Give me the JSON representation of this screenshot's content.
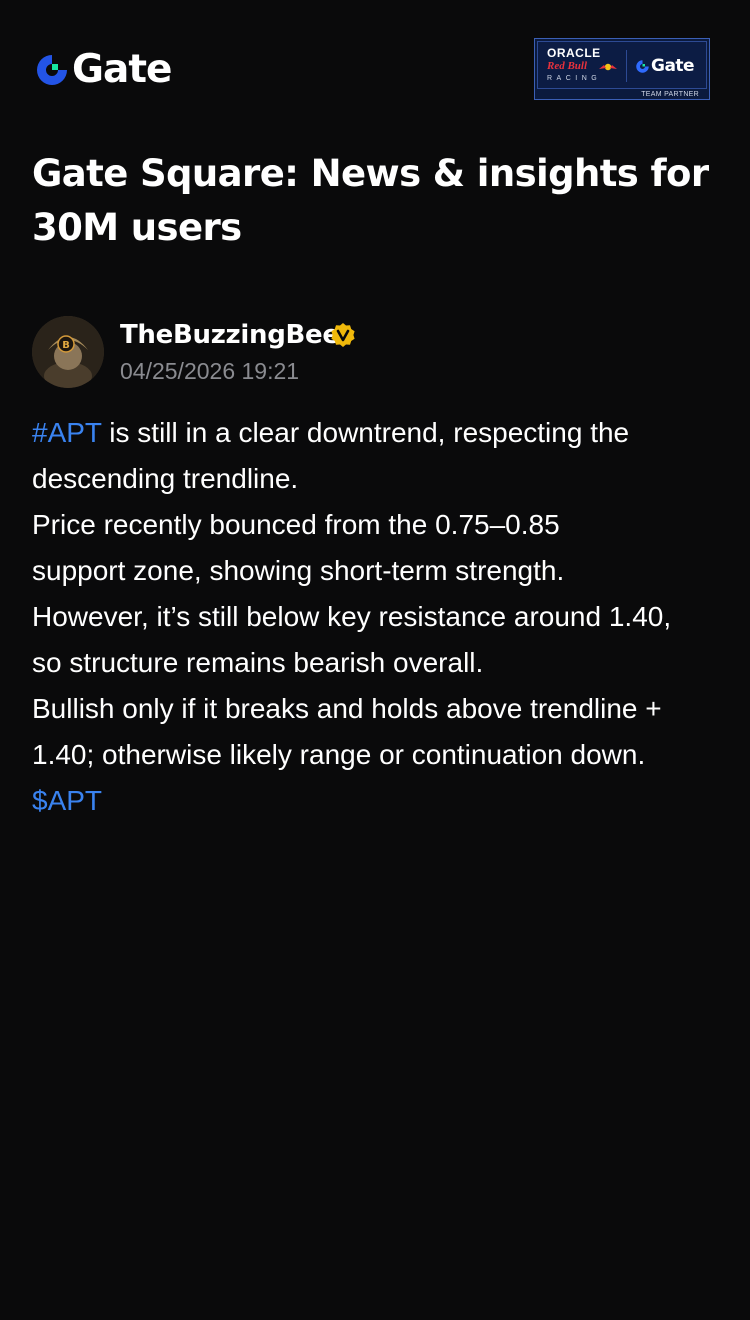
{
  "header": {
    "logo_text": "Gate",
    "partner_badge": {
      "oracle": "ORACLE",
      "redbull": "Red Bull",
      "racing": "RACING",
      "gate": "Gate",
      "team_partner": "TEAM PARTNER"
    }
  },
  "page": {
    "title_line1": "Gate Square: News & insights for",
    "title_line2": "30M users"
  },
  "post": {
    "author": "TheBuzzingBee",
    "timestamp": "04/25/2026 19:21",
    "body": {
      "hashtag": "#APT",
      "line1_rest": " is still in a clear downtrend, respecting the",
      "line2": "descending trendline.",
      "line3": "Price recently bounced from the 0.75–0.85",
      "line4": "support zone, showing short-term strength.",
      "line5": "However, it’s still below key resistance around 1.40,",
      "line6": "so structure remains bearish overall.",
      "line7": "Bullish only if it breaks and holds above trendline +",
      "line8": "1.40; otherwise likely range or continuation down.",
      "cashtag": "$APT"
    }
  },
  "colors": {
    "background": "#0a0a0b",
    "brand_blue": "#2354e6",
    "brand_green": "#17e6a1",
    "link": "#3a83f0",
    "muted_text": "#8a8b90",
    "verified": "#f0b90b"
  },
  "icons": {
    "logo": "gate-logo-icon",
    "verified": "verified-badge-icon",
    "avatar": "user-avatar"
  }
}
